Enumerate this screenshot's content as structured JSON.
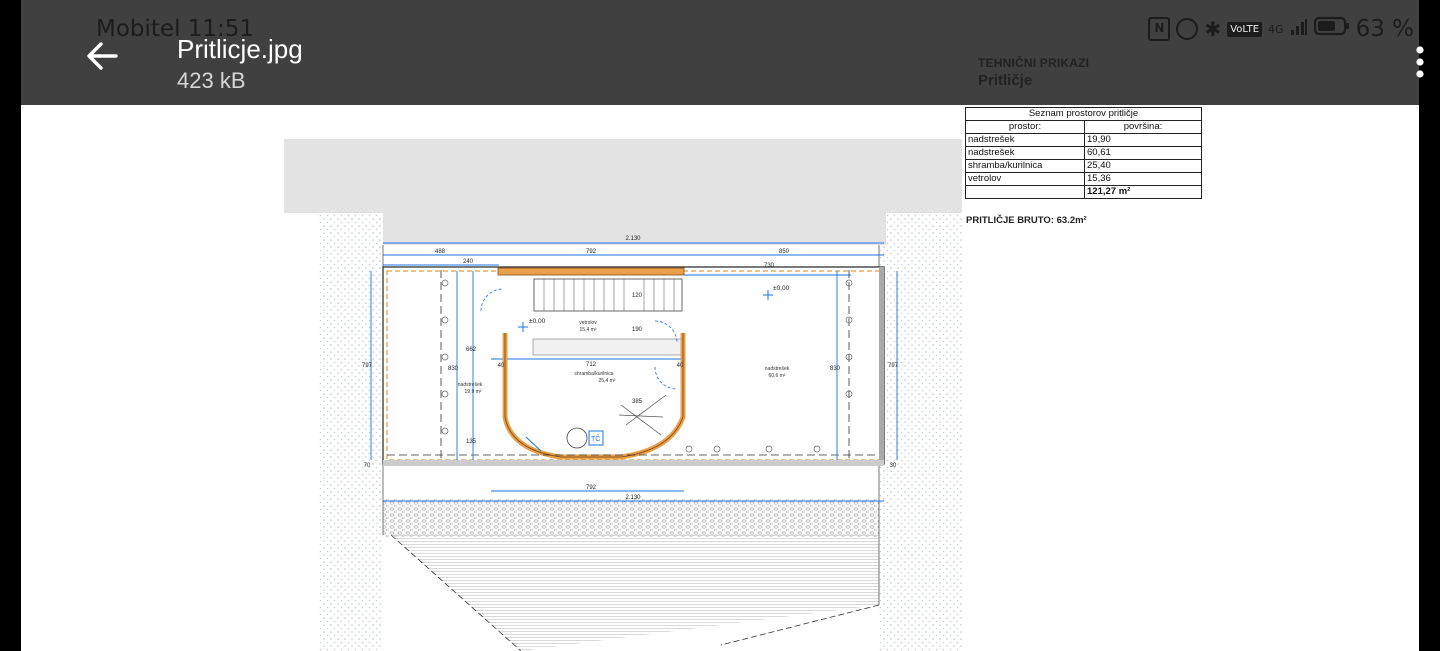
{
  "status_bar": {
    "carrier_time": "Mobitel 11:51",
    "battery_percent": "63 %",
    "network": "4G"
  },
  "header": {
    "file_name": "Pritlicje.jpg",
    "file_size": "423 kB"
  },
  "drawing": {
    "section_label": "TEHNIČNI PRIKAZI",
    "sheet_title": "Pritličje",
    "room_table": {
      "title": "Seznam prostorov pritličje",
      "headers": [
        "prostor:",
        "površina:"
      ],
      "rows": [
        [
          "nadstrešek",
          "19,90"
        ],
        [
          "nadstrešek",
          "60,61"
        ],
        [
          "shramba/kurilnica",
          "25,40"
        ],
        [
          "vetrolov",
          "15,36"
        ]
      ],
      "total": "121,27 m²"
    },
    "bruto": "PRITLIČJE BRUTO: 63.2m²",
    "dimensions": {
      "total_width": "2.130",
      "d488": "488",
      "d792": "792",
      "d850": "850",
      "d240": "240",
      "d730": "730",
      "d712": "712",
      "d797": "797",
      "d830": "830",
      "d662": "662",
      "d135": "135",
      "d70": "70",
      "d120": "120",
      "d190": "190",
      "d385": "385",
      "d40": "40",
      "d30": "30",
      "bottom_792": "792",
      "bottom_total": "2.130"
    },
    "rooms": {
      "vetrolov": "vetrolov",
      "vetrolov_area": "15,4 m²",
      "shramba": "shramba/kurilnica",
      "shramba_area": "25,4 m²",
      "nadstresek_left": "nadstrešek",
      "nadstresek_left_area": "19,9 m²",
      "nadstresek_right": "nadstrešek",
      "nadstresek_right_area": "60,6 m²",
      "level_1": "±0,00",
      "level_2": "±0,00",
      "tc": "TČ"
    }
  }
}
